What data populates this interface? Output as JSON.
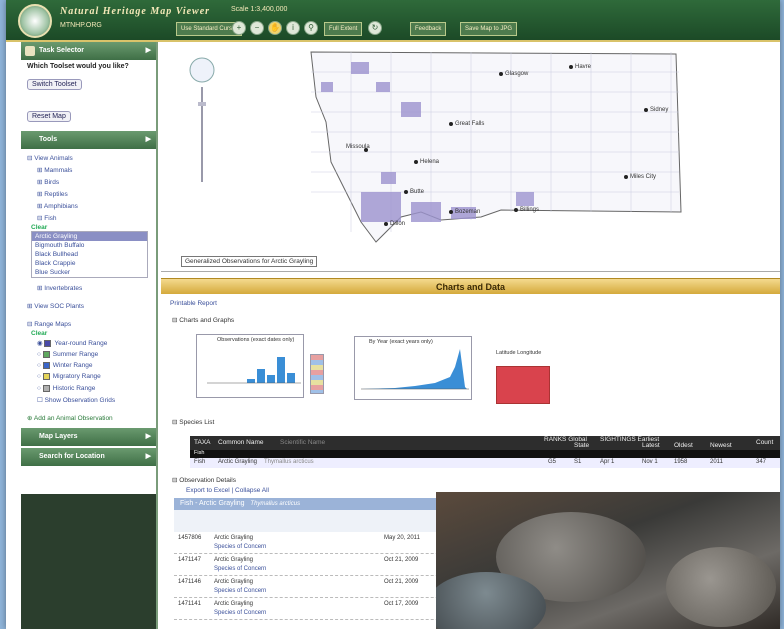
{
  "header": {
    "title": "Natural Heritage Map Viewer",
    "org": "MTNHP.ORG",
    "scale_text": "Scale 1:3,400,000",
    "buttons": [
      "Use Standard Cursor",
      "Full Extent",
      "Feedback",
      "Save Map to JPG"
    ]
  },
  "sidebar": {
    "task_selector": "Task Selector",
    "question": "Which Toolset would you like?",
    "switch_toolset": "Switch Toolset",
    "reset_map": "Reset Map",
    "tools": "Tools",
    "tree": [
      {
        "label": "View Animals",
        "level": 0
      },
      {
        "label": "Mammals",
        "level": 1
      },
      {
        "label": "Birds",
        "level": 1
      },
      {
        "label": "Reptiles",
        "level": 1
      },
      {
        "label": "Amphibians",
        "level": 1
      },
      {
        "label": "Fish",
        "level": 1
      }
    ],
    "clear": "Clear",
    "species": [
      "Arctic Grayling",
      "Bigmouth Buffalo",
      "Black Bullhead",
      "Black Crappie",
      "Blue Sucker"
    ],
    "more_tree": [
      {
        "label": "Invertebrates",
        "level": 1
      },
      {
        "label": "View SOC Plants",
        "level": 0
      },
      {
        "label": "Range Maps",
        "level": 0
      }
    ],
    "range_clear": "Clear",
    "ranges": [
      {
        "label": "Year-round Range",
        "color": "#4a4aa8"
      },
      {
        "label": "Summer Range",
        "color": "#5fa85f"
      },
      {
        "label": "Winter Range",
        "color": "#3b66c9"
      },
      {
        "label": "Migratory Range",
        "color": "#e5d55a"
      },
      {
        "label": "Historic Range",
        "color": "#b0b0b0"
      },
      {
        "label": "Show Observation Grids",
        "color": "#ffffff"
      }
    ],
    "add_observation": "Add an Animal Observation",
    "map_layers": "Map Layers",
    "search_location": "Search for Location"
  },
  "map": {
    "cities": [
      "Glasgow",
      "Havre",
      "Sidney",
      "Great Falls",
      "Missoula",
      "Helena",
      "Butte",
      "Miles City",
      "Bozeman",
      "Billings",
      "Dillon"
    ],
    "legend_button": "Generalized Observations for Arctic Grayling"
  },
  "charts_section": {
    "title": "Charts and Data",
    "printable_report": "Printable Report",
    "charts_and_graphs": "Charts and Graphs",
    "chart1_title": "Observations (exact dates only)",
    "chart2_title": "By Year (exact years only)",
    "elev_label": "Latitude Longitude",
    "species_list": "Species List",
    "table_headers": [
      "TAXA",
      "Common Name",
      "Scientific Name",
      "RANKS Global",
      "State",
      "SIGHTINGS Earliest",
      "Latest",
      "Oldest",
      "Newest",
      "Count"
    ],
    "fish_row": "Fish",
    "species_row": [
      "Fish",
      "Arctic Grayling",
      "Thymallus arcticus",
      "G5",
      "S1",
      "Apr 1",
      "Nov 1",
      "1958",
      "2011",
      "347"
    ],
    "observation_details": "Observation Details",
    "export_links": "Export to Excel | Collapse All",
    "obs_group": "Fish - Arctic Grayling",
    "obs_group_sci": "Thymallus arcticus",
    "obs_rows": [
      {
        "id": "1457806",
        "name": "Arctic Grayling",
        "date": "May 20, 2011",
        "soc": "Species of Concern"
      },
      {
        "id": "1471147",
        "name": "Arctic Grayling",
        "date": "Oct 21, 2009",
        "soc": "Species of Concern"
      },
      {
        "id": "1471146",
        "name": "Arctic Grayling",
        "date": "Oct 21, 2009",
        "soc": "Species of Concern"
      },
      {
        "id": "1471141",
        "name": "Arctic Grayling",
        "date": "Oct 17, 2009",
        "soc": "Species of Concern"
      }
    ]
  },
  "colors": {
    "header_green": "#2f6a3a",
    "accent_gold": "#d4a93b",
    "selection": "#8a8fc4"
  }
}
